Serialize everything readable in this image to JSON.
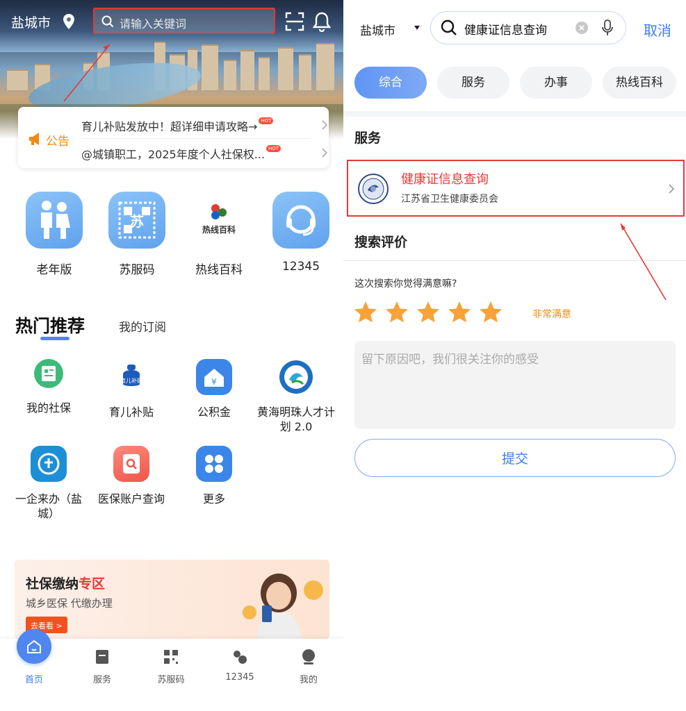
{
  "left": {
    "location": "盐城市",
    "search_placeholder": "请输入关键词",
    "notice": {
      "label": "公告",
      "items": [
        {
          "text": "育儿补贴发放中！超详细申请攻略→",
          "badge": "HOT"
        },
        {
          "text": "@城镇职工，2025年度个人社保权...",
          "badge": "HOT"
        }
      ]
    },
    "quick_actions": [
      {
        "label": "老年版",
        "icon": "elderly-couple-icon"
      },
      {
        "label": "苏服码",
        "icon": "qr-code-icon"
      },
      {
        "label": "热线百科",
        "icon": "hotline-encyclopedia-icon",
        "logo_text": "热线百科"
      },
      {
        "label": "12345",
        "icon": "headset-icon"
      }
    ],
    "section": {
      "active_tab": "热门推荐",
      "tab2": "我的订阅"
    },
    "services": [
      {
        "label": "我的社保",
        "icon": "social-security-icon"
      },
      {
        "label": "育儿补贴",
        "icon": "childcare-subsidy-icon",
        "logo_text": "育儿补贴"
      },
      {
        "label": "公积金",
        "icon": "housing-fund-icon"
      },
      {
        "label": "黄海明珠人才计划 2.0",
        "icon": "talent-plan-icon"
      },
      {
        "label": "一企来办（盐城）",
        "icon": "enterprise-service-icon"
      },
      {
        "label": "医保账户查询",
        "icon": "medical-insurance-icon"
      },
      {
        "label": "更多",
        "icon": "more-grid-icon"
      }
    ],
    "banner": {
      "title_prefix": "社保缴纳",
      "title_highlight": "专区",
      "subtitle": "城乡医保 代缴办理",
      "button": "去看看 >"
    },
    "tabbar": [
      {
        "label": "首页",
        "icon": "home-icon",
        "active": true
      },
      {
        "label": "服务",
        "icon": "service-icon",
        "active": false
      },
      {
        "label": "苏服码",
        "icon": "qr-code-icon",
        "active": false
      },
      {
        "label": "12345",
        "icon": "hotline-icon",
        "active": false
      },
      {
        "label": "我的",
        "icon": "profile-icon",
        "active": false
      }
    ]
  },
  "right": {
    "location": "盐城市",
    "search_value": "健康证信息查询",
    "cancel": "取消",
    "chips": [
      {
        "label": "综合",
        "active": true
      },
      {
        "label": "服务",
        "active": false
      },
      {
        "label": "办事",
        "active": false
      },
      {
        "label": "热线百科",
        "active": false
      }
    ],
    "section_title": "服务",
    "result": {
      "title": "健康证信息查询",
      "subtitle": "江苏省卫生健康委员会"
    },
    "rating": {
      "title": "搜索评价",
      "question": "这次搜索你觉得满意嘛?",
      "stars": 5,
      "max": 5,
      "label": "非常满意",
      "feedback_placeholder": "留下原因吧，我们很关注你的感受",
      "submit": "提交"
    }
  },
  "colors": {
    "accent": "#3b7cf0",
    "highlight_red": "#e53935",
    "star": "#f5a33a",
    "notice_orange": "#f08a16"
  }
}
